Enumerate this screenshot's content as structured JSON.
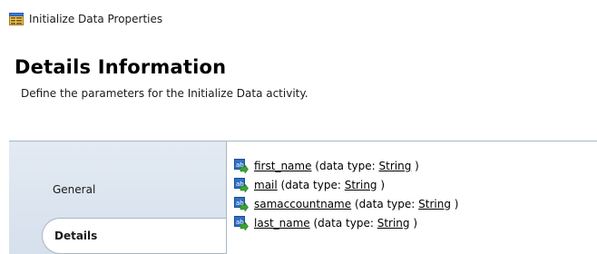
{
  "window": {
    "title": "Initialize Data Properties",
    "icon": "properties-window-icon"
  },
  "header": {
    "title": "Details Information",
    "description": "Define the parameters for the Initialize Data activity."
  },
  "tabs": [
    {
      "label": "General",
      "selected": false
    },
    {
      "label": "Details",
      "selected": true
    }
  ],
  "properties": [
    {
      "name": "first_name",
      "prefix": " (data type: ",
      "type": "String",
      "suffix": " )"
    },
    {
      "name": "mail",
      "prefix": " (data type: ",
      "type": "String",
      "suffix": " )"
    },
    {
      "name": "samaccountname",
      "prefix": " (data type: ",
      "type": "String",
      "suffix": " )"
    },
    {
      "name": "last_name",
      "prefix": " (data type: ",
      "type": "String",
      "suffix": " )"
    }
  ],
  "colors": {
    "tab_bar": "#dbe3ee",
    "border": "#a9b6c4",
    "icon_blue": "#2f6fc4",
    "icon_green": "#3aa335"
  }
}
